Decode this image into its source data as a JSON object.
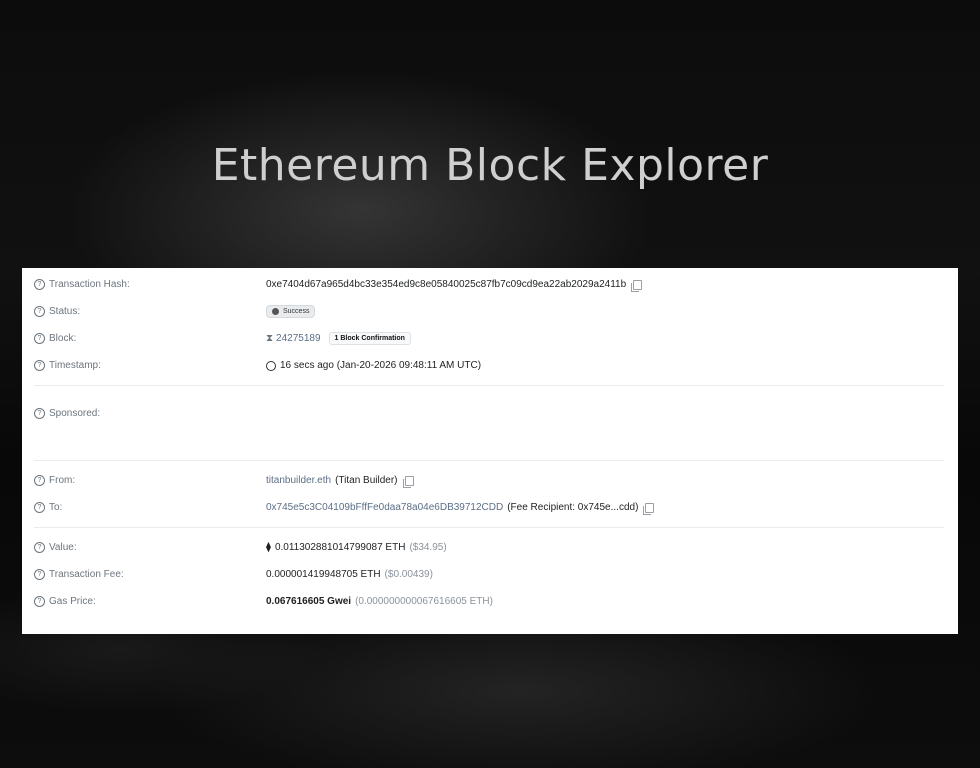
{
  "headline": "Ethereum Block Explorer",
  "tx": {
    "hash_label": "Transaction Hash:",
    "hash": "0xe7404d67a965d4bc33e354ed9c8e05840025c87fb7c09cd9ea22ab2029a2411b",
    "status_label": "Status:",
    "status": "Success",
    "block_label": "Block:",
    "block": "24275189",
    "confirmations": "1 Block Confirmation",
    "timestamp_label": "Timestamp:",
    "timestamp": "16 secs ago (Jan-20-2026 09:48:11 AM UTC)",
    "sponsored_label": "Sponsored:",
    "from_label": "From:",
    "from": "titanbuilder.eth",
    "from_note": "(Titan Builder)",
    "to_label": "To:",
    "to": "0x745e5c3C04109bFffFe0daa78a04e6DB39712CDD",
    "to_note": "(Fee Recipient: 0x745e...cdd)",
    "value_label": "Value:",
    "value": "0.011302881014799087 ETH",
    "value_usd": "($34.95)",
    "fee_label": "Transaction Fee:",
    "fee": "0.000001419948705 ETH",
    "fee_usd": "($0.00439)",
    "gas_label": "Gas Price:",
    "gas": "0.067616605 Gwei",
    "gas_eth": "(0.000000000067616605 ETH)"
  },
  "icons": {
    "help": "question-circle-icon",
    "copy": "copy-icon",
    "block": "hourglass-icon",
    "time": "clock-icon",
    "eth": "ethereum-icon",
    "success": "check-circle-icon"
  }
}
